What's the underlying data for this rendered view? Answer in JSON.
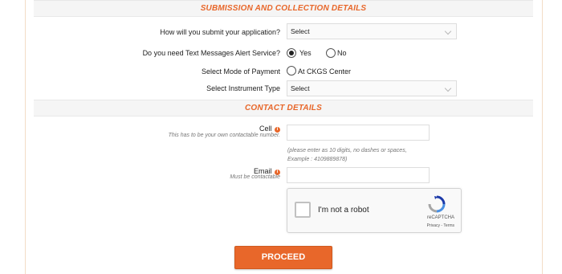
{
  "submission": {
    "heading": "SUBMISSION AND COLLECTION DETAILS",
    "submit_label": "How will you submit your application?",
    "submit_value": "Select",
    "sms_label": "Do you need Text Messages Alert Service?",
    "sms_options": [
      "Yes",
      "No"
    ],
    "sms_selected": "Yes",
    "payment_label": "Select Mode of Payment",
    "payment_option": "At CKGS Center",
    "instrument_label": "Select Instrument Type",
    "instrument_value": "Select"
  },
  "contact": {
    "heading": "CONTACT DETAILS",
    "cell_label": "Cell",
    "cell_hint": "This has to be your own contactable number.",
    "cell_note_line1": "(please enter as 10 digits, no dashes or spaces,",
    "cell_note_line2": "Example : 4109889878)",
    "email_label": "Email",
    "email_hint": "Must be contactable",
    "info_glyph": "i"
  },
  "captcha": {
    "text": "I'm not a robot",
    "brand": "reCAPTCHA",
    "terms": "Privacy - Terms"
  },
  "actions": {
    "proceed_label": "PROCEED"
  },
  "colors": {
    "accent": "#e8672a"
  }
}
